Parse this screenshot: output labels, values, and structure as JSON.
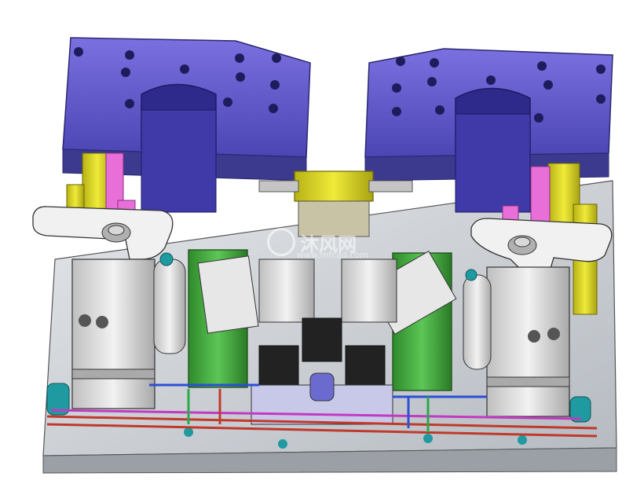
{
  "scene": {
    "subject": "fixture-assembly-render",
    "colors": {
      "background": "#ffffff",
      "base_plate": "#c9cdd2",
      "block_blue": "#6a5acd",
      "block_blue_dark": "#3b3a8f",
      "cylinder_grey": "#d6d6d6",
      "green_bracket": "#3fa83a",
      "yellow_part": "#d9d41c",
      "pink_part": "#e86fd8",
      "teal_fitting": "#1f9aa0",
      "pipe_red": "#c0392b",
      "pipe_blue": "#2b4fd6",
      "pipe_green": "#2aa84a",
      "pipe_magenta": "#c23ac2"
    }
  },
  "watermark": {
    "text_cn": "沐风网",
    "text_en": "www.mfcad.com"
  }
}
